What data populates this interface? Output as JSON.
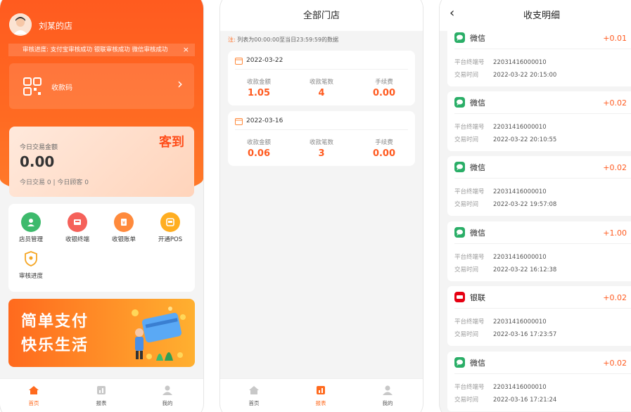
{
  "screen1": {
    "store_name": "刘某的店",
    "notice": "审核进度: 支付宝审核成功 银联审核成功 微信审核成功",
    "notice_close": "×",
    "qr_label": "收款码",
    "qr_arrow": "›",
    "checkin": "客到",
    "today_label": "今日交易金额",
    "today_amount": "0.00",
    "today_sub": "今日交易 0   |   今日顾客 0",
    "grid": [
      {
        "label": "店员管理",
        "icon": "staff-icon",
        "color": "#3dba6c"
      },
      {
        "label": "收银终端",
        "icon": "terminal-icon",
        "color": "#f5615a"
      },
      {
        "label": "收银账单",
        "icon": "bill-icon",
        "color": "#ff8a3c"
      },
      {
        "label": "开通POS",
        "icon": "pos-icon",
        "color": "#ffae21"
      },
      {
        "label": "审核进度",
        "icon": "shield-icon",
        "color": "#f5a623"
      }
    ],
    "banner_line1": "简单支付",
    "banner_line2": "快乐生活",
    "tabs": [
      {
        "label": "首页",
        "icon": "home-icon"
      },
      {
        "label": "报表",
        "icon": "report-icon"
      },
      {
        "label": "我的",
        "icon": "user-icon"
      }
    ],
    "active_tab": 0
  },
  "screen2": {
    "title": "全部门店",
    "note_mark": "注:",
    "note": "列表为00:00:00至当日23:59:59的数据",
    "stores": [
      {
        "date": "2022-03-22",
        "stats": [
          {
            "label": "收款金额",
            "value": "1.05"
          },
          {
            "label": "收款笔数",
            "value": "4"
          },
          {
            "label": "手续费",
            "value": "0.00"
          }
        ]
      },
      {
        "date": "2022-03-16",
        "stats": [
          {
            "label": "收款金额",
            "value": "0.06"
          },
          {
            "label": "收款笔数",
            "value": "3"
          },
          {
            "label": "手续费",
            "value": "0.00"
          }
        ]
      }
    ],
    "tabs": [
      {
        "label": "首页",
        "icon": "home-icon"
      },
      {
        "label": "报表",
        "icon": "report-icon"
      },
      {
        "label": "我的",
        "icon": "user-icon"
      }
    ],
    "active_tab": 1
  },
  "screen3": {
    "title": "收支明细",
    "back": "‹",
    "field_terminal": "平台终端号",
    "field_time": "交易时间",
    "transactions": [
      {
        "channel": "微信",
        "type": "wechat",
        "amount": "+0.01",
        "terminal": "22031416000010",
        "time": "2022-03-22 20:15:00"
      },
      {
        "channel": "微信",
        "type": "wechat",
        "amount": "+0.02",
        "terminal": "22031416000010",
        "time": "2022-03-22 20:10:55"
      },
      {
        "channel": "微信",
        "type": "wechat",
        "amount": "+0.02",
        "terminal": "22031416000010",
        "time": "2022-03-22 19:57:08"
      },
      {
        "channel": "微信",
        "type": "wechat",
        "amount": "+1.00",
        "terminal": "22031416000010",
        "time": "2022-03-22 16:12:38"
      },
      {
        "channel": "银联",
        "type": "unionpay",
        "amount": "+0.02",
        "terminal": "22031416000010",
        "time": "2022-03-16 17:23:57"
      },
      {
        "channel": "微信",
        "type": "wechat",
        "amount": "+0.02",
        "terminal": "22031416000010",
        "time": "2022-03-16 17:21:24"
      }
    ]
  },
  "colors": {
    "accent": "#ff5a1f",
    "wechat": "#2aae67",
    "unionpay": "#e60012"
  }
}
